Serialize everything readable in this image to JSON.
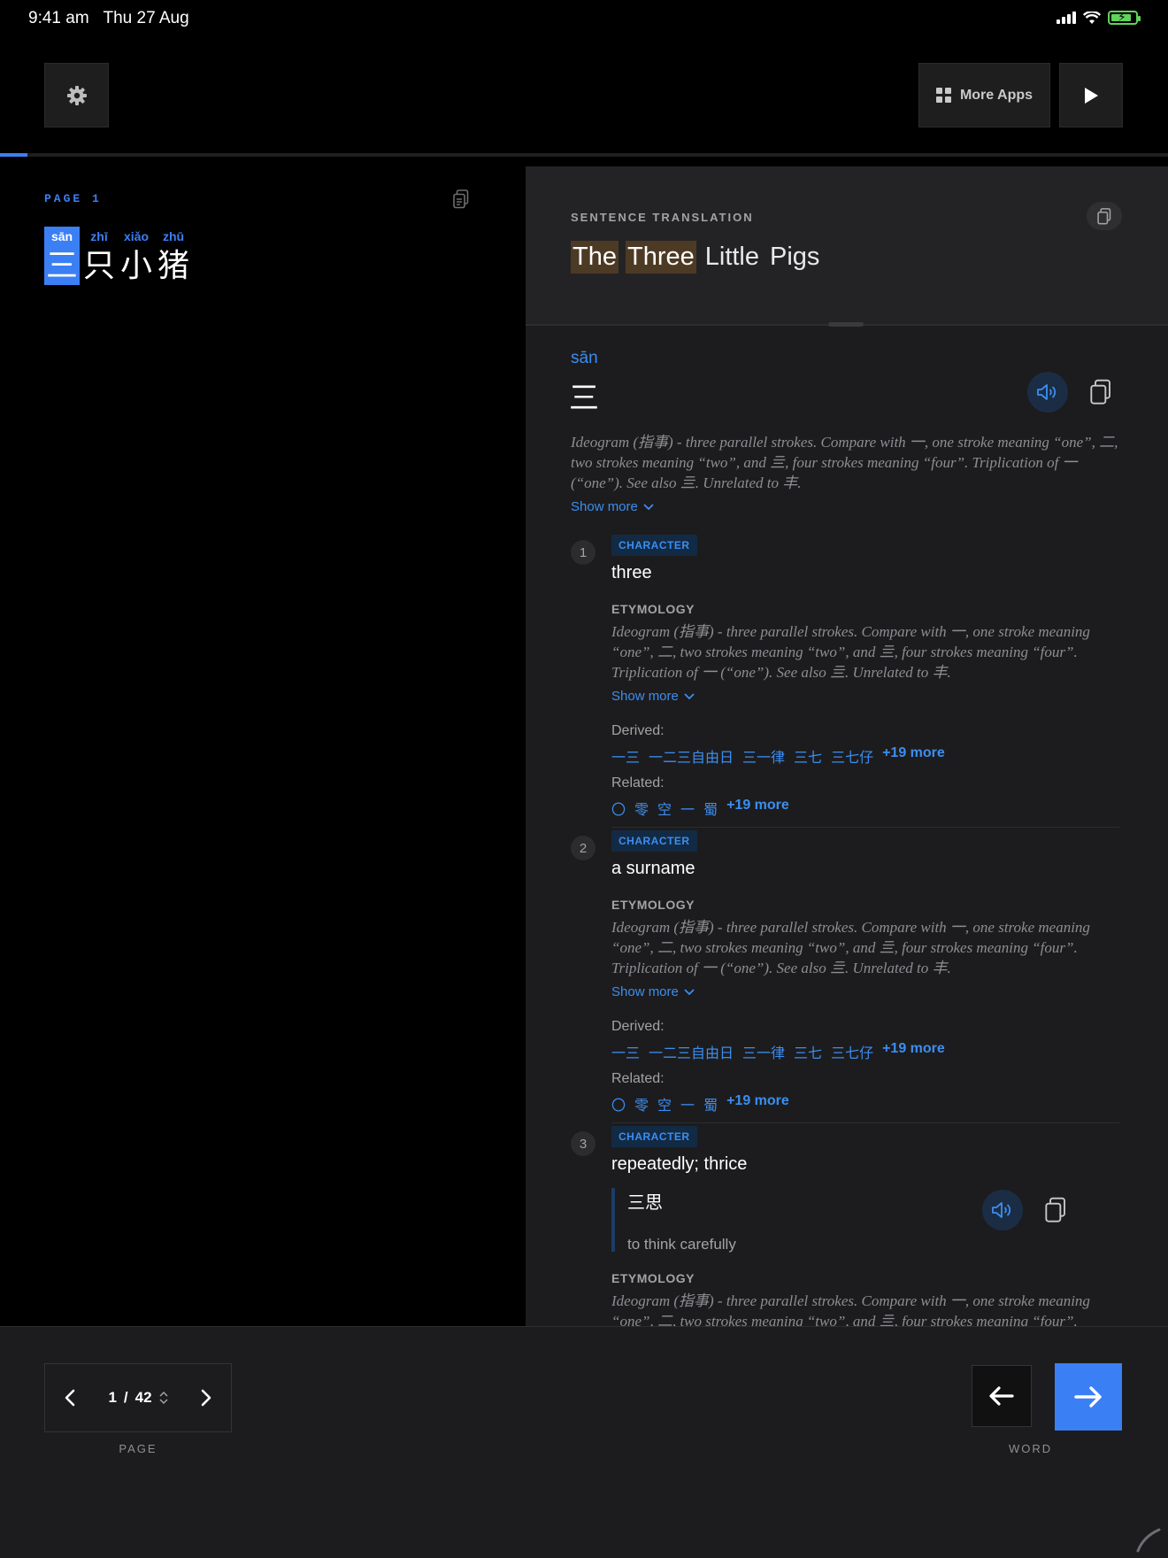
{
  "status_bar": {
    "time": "9:41 am",
    "date": "Thu 27 Aug"
  },
  "toolbar": {
    "more_apps_label": "More Apps"
  },
  "reading": {
    "page_label": "PAGE 1",
    "characters": [
      {
        "pinyin": "sān",
        "hanzi": "三",
        "active": true
      },
      {
        "pinyin": "zhī",
        "hanzi": "只",
        "active": false
      },
      {
        "pinyin": "xiǎo",
        "hanzi": "小",
        "active": false
      },
      {
        "pinyin": "zhū",
        "hanzi": "猪",
        "active": false
      }
    ]
  },
  "translation": {
    "label": "SENTENCE TRANSLATION",
    "words": [
      {
        "text": "The",
        "highlighted": true
      },
      {
        "text": "Three",
        "highlighted": true
      },
      {
        "text": "Little",
        "highlighted": false
      },
      {
        "text": "Pigs",
        "highlighted": false
      }
    ]
  },
  "word": {
    "pinyin": "sān",
    "hanzi": "三",
    "etymology": "Ideogram (指事) - three parallel strokes. Compare with 一, one stroke meaning “one”, 二, two strokes meaning “two”, and 亖, four strokes meaning “four”. Triplication of 一 (“one”). See also 亖. Unrelated to 丰.",
    "show_more": "Show more"
  },
  "senses": [
    {
      "number": "1",
      "tag": "CHARACTER",
      "meaning": "three",
      "etymology_label": "ETYMOLOGY",
      "etymology": "Ideogram (指事) - three parallel strokes. Compare with 一, one stroke meaning “one”, 二, two strokes meaning “two”, and 亖, four strokes meaning “four”. Triplication of 一 (“one”). See also 亖. Unrelated to 丰.",
      "show_more": "Show more",
      "derived_label": "Derived:",
      "derived": [
        "一三",
        "一二三自由日",
        "三一律",
        "三七",
        "三七仔"
      ],
      "derived_more": "+19 more",
      "related_label": "Related:",
      "related": [
        "〇",
        "零",
        "空",
        "一",
        "蜀"
      ],
      "related_more": "+19 more"
    },
    {
      "number": "2",
      "tag": "CHARACTER",
      "meaning": "a surname",
      "etymology_label": "ETYMOLOGY",
      "etymology": "Ideogram (指事) - three parallel strokes. Compare with 一, one stroke meaning “one”, 二, two strokes meaning “two”, and 亖, four strokes meaning “four”. Triplication of 一 (“one”). See also 亖. Unrelated to 丰.",
      "show_more": "Show more",
      "derived_label": "Derived:",
      "derived": [
        "一三",
        "一二三自由日",
        "三一律",
        "三七",
        "三七仔"
      ],
      "derived_more": "+19 more",
      "related_label": "Related:",
      "related": [
        "〇",
        "零",
        "空",
        "一",
        "蜀"
      ],
      "related_more": "+19 more"
    },
    {
      "number": "3",
      "tag": "CHARACTER",
      "meaning": "repeatedly; thrice",
      "example_hanzi": "三思",
      "example_translation": "to think carefully",
      "etymology_label": "ETYMOLOGY",
      "etymology": "Ideogram (指事) - three parallel strokes. Compare with 一, one stroke meaning “one”, 二, two strokes meaning “two”, and 亖, four strokes meaning “four”."
    }
  ],
  "pager": {
    "current": "1",
    "separator": "/",
    "total": "42",
    "caption": "PAGE"
  },
  "word_nav": {
    "caption": "WORD"
  },
  "colors": {
    "accent": "#3b7ff5",
    "link": "#3b8ef0",
    "highlight": "#4d3a24",
    "panel": "#1c1c1e"
  },
  "icons": [
    "gear-icon",
    "apps-grid-icon",
    "play-icon",
    "copy-icon",
    "speaker-icon",
    "chevron-down-icon",
    "chevron-left-icon",
    "chevron-right-icon",
    "arrow-left-icon",
    "arrow-right-icon",
    "wifi-icon",
    "signal-icon",
    "battery-icon"
  ]
}
